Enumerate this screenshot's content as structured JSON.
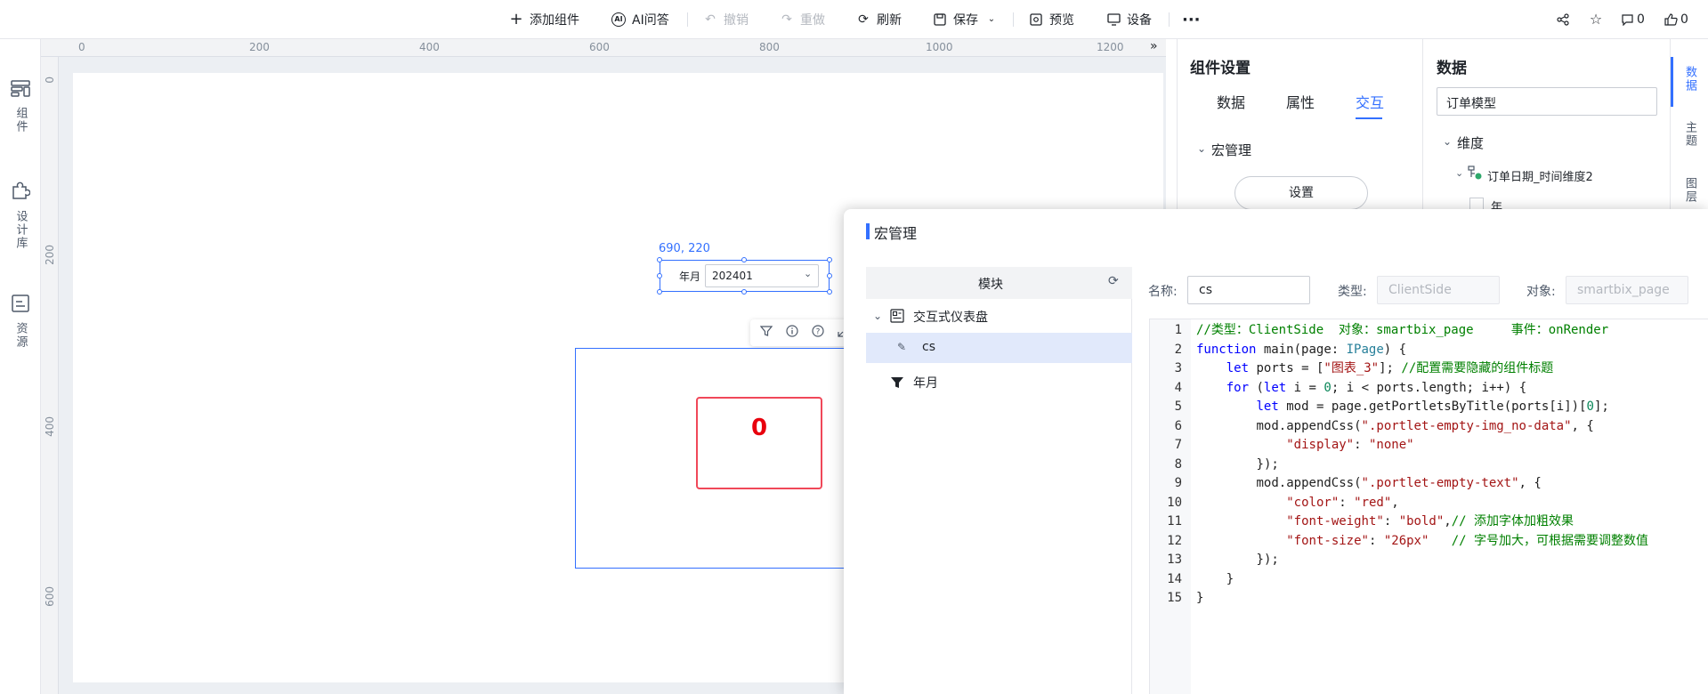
{
  "toolbar": {
    "add_component": "添加组件",
    "ai_qa": "AI问答",
    "undo": "撤销",
    "redo": "重做",
    "refresh": "刷新",
    "save": "保存",
    "preview": "预览",
    "device": "设备",
    "comments_count": "0",
    "likes_count": "0"
  },
  "left_sidebar": {
    "components": "组件",
    "design_library": "设计库",
    "resources": "资源"
  },
  "ruler": {
    "h_ticks": [
      "0",
      "200",
      "400",
      "600",
      "800",
      "1000",
      "1200"
    ],
    "v_ticks": [
      "0",
      "200",
      "400",
      "600"
    ]
  },
  "canvas": {
    "coords": "690, 220",
    "filter_label": "年月",
    "filter_value": "202401",
    "chart_value": "0"
  },
  "settings_panel": {
    "title": "组件设置",
    "tabs": [
      "数据",
      "属性",
      "交互"
    ],
    "active_tab": "交互",
    "section": "宏管理",
    "setup_button": "设置"
  },
  "data_panel": {
    "title": "数据",
    "model": "订单模型",
    "dimension": "维度",
    "field": "订单日期_时间维度2",
    "sub_field": "年"
  },
  "right_rail": {
    "tabs": [
      "数据",
      "主题",
      "图层"
    ]
  },
  "macro_dialog": {
    "title": "宏管理",
    "tree_header": "模块",
    "tree": {
      "root": "交互式仪表盘",
      "items": [
        "cs",
        "年月"
      ]
    },
    "name_label": "名称:",
    "name_value": "cs",
    "type_label": "类型:",
    "type_value": "ClientSide",
    "object_label": "对象:",
    "object_value": "smartbix_page"
  },
  "code": {
    "lines": [
      "//类型：ClientSide  对象：smartbix_page     事件：onRender",
      "function main(page: IPage) {",
      "    let ports = [\"图表_3\"]; //配置需要隐藏的组件标题",
      "    for (let i = 0; i < ports.length; i++) {",
      "        let mod = page.getPortletsByTitle(ports[i])[0];",
      "        mod.appendCss(\".portlet-empty-img_no-data\", {",
      "            \"display\": \"none\"",
      "        });",
      "        mod.appendCss(\".portlet-empty-text\", {",
      "            \"color\": \"red\",",
      "            \"font-weight\": \"bold\",// 添加字体加粗效果",
      "            \"font-size\": \"26px\"   // 字号加大，可根据需要调整数值",
      "        });",
      "    }",
      "}"
    ]
  },
  "colors": {
    "accent": "#3370ff",
    "chart_border": "#f04859",
    "chart_value": "#e8000d"
  }
}
